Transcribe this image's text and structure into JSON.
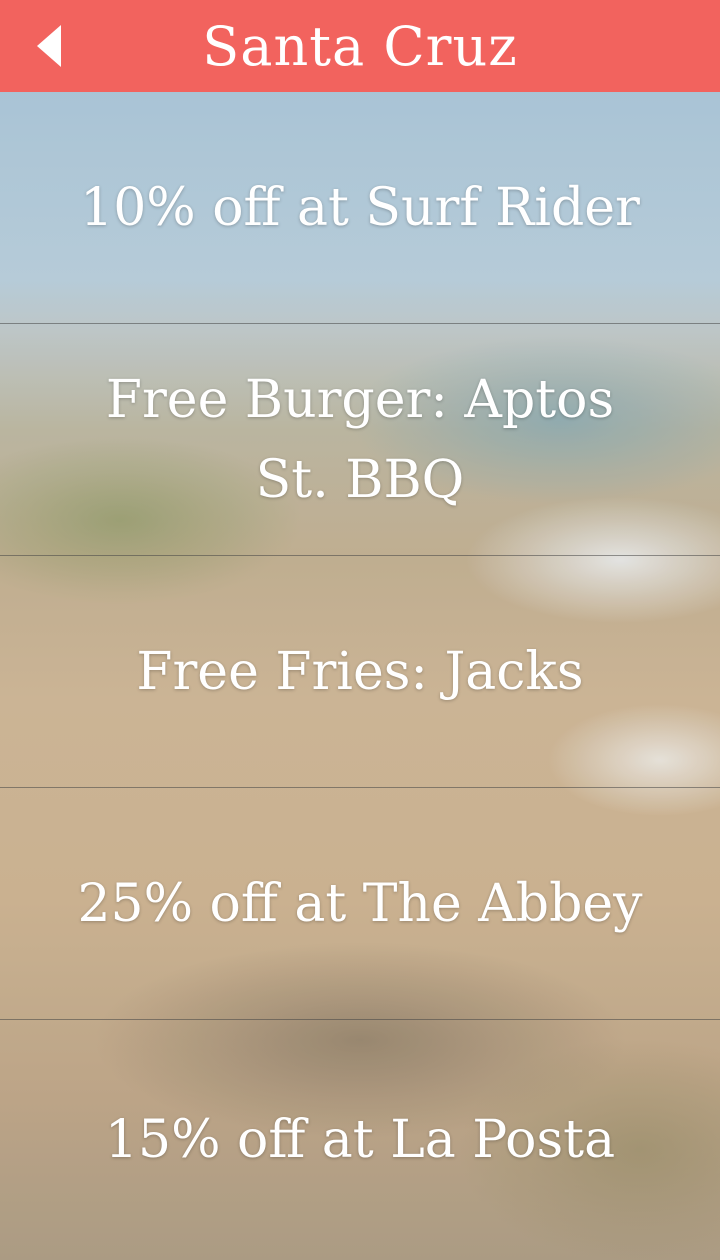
{
  "header": {
    "title": "Santa Cruz",
    "back_icon": "back-arrow-icon",
    "background_color": "#f2635e"
  },
  "deals": [
    {
      "label": "10% off at Surf Rider"
    },
    {
      "label": "Free Burger: Aptos St. BBQ"
    },
    {
      "label": "Free Fries: Jacks"
    },
    {
      "label": "25% off at The Abbey"
    },
    {
      "label": "15% off at La Posta"
    }
  ]
}
